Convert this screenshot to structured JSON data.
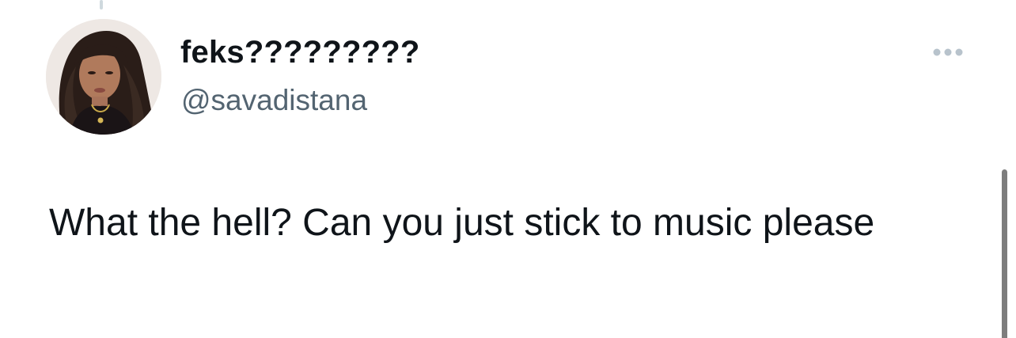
{
  "tweet": {
    "author_name": "feks?????????",
    "author_handle": "@savadistana",
    "text": "What the hell? Can you just stick to music please"
  },
  "icons": {
    "more": "more-horizontal-icon",
    "avatar": "user-avatar"
  },
  "colors": {
    "name": "#0f1419",
    "handle": "#536471",
    "text": "#0f1419",
    "more_icon": "#b8c3cc",
    "background": "#ffffff"
  }
}
